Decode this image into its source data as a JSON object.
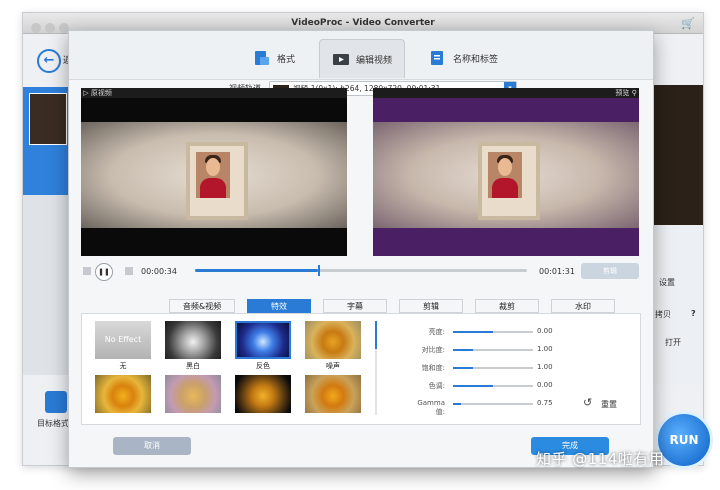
{
  "app": {
    "title": "VideoProc - Video Converter",
    "back_label": "返",
    "target_format_label": "目标格式",
    "run_label": "RUN",
    "right_panel": {
      "settings": "设置",
      "auto_copy": "拷贝",
      "question": "?",
      "open": "打开"
    }
  },
  "dialog": {
    "tabs": [
      {
        "label": "格式",
        "icon": "format-icon",
        "active": false
      },
      {
        "label": "编辑视频",
        "icon": "edit-video-icon",
        "active": true
      },
      {
        "label": "名称和标签",
        "icon": "name-tag-icon",
        "active": false
      }
    ],
    "track": {
      "label": "视频轨道",
      "value": "视频-1(0x1): h264, 1280x720, 00:01:31"
    },
    "source_label": "原视频",
    "preview_label": "预览",
    "player": {
      "current_time": "00:00:34",
      "end_time": "00:01:31",
      "progress": 0.37,
      "snapshot_label": "剪辑"
    },
    "edit_tabs": [
      {
        "label": "音频&视频",
        "active": false
      },
      {
        "label": "特效",
        "active": true
      },
      {
        "label": "字幕",
        "active": false
      },
      {
        "label": "剪辑",
        "active": false
      },
      {
        "label": "裁剪",
        "active": false
      },
      {
        "label": "水印",
        "active": false
      }
    ],
    "effects": [
      {
        "label": "无",
        "thumb_text": "No Effect",
        "style": "none",
        "selected": false
      },
      {
        "label": "黑白",
        "thumb_text": "",
        "style": "bw",
        "selected": false
      },
      {
        "label": "反色",
        "thumb_text": "",
        "style": "invert",
        "selected": true
      },
      {
        "label": "噪声",
        "thumb_text": "",
        "style": "noise",
        "selected": false
      },
      {
        "label": "",
        "thumb_text": "",
        "style": "vivid",
        "selected": false
      },
      {
        "label": "",
        "thumb_text": "",
        "style": "fade",
        "selected": false
      },
      {
        "label": "",
        "thumb_text": "",
        "style": "vignette",
        "selected": false
      },
      {
        "label": "",
        "thumb_text": "",
        "style": "warm",
        "selected": false
      }
    ],
    "adjustments": [
      {
        "label": "亮度:",
        "value": "0.00",
        "level": 0.5
      },
      {
        "label": "对比度:",
        "value": "1.00",
        "level": 0.25
      },
      {
        "label": "饱和度:",
        "value": "1.00",
        "level": 0.25
      },
      {
        "label": "色调:",
        "value": "0.00",
        "level": 0.5
      },
      {
        "label": "Gamma值:",
        "value": "0.75",
        "level": 0.1
      }
    ],
    "reset_label": "重置",
    "cancel_label": "取消",
    "done_label": "完成"
  },
  "watermark": "知乎 @114啦有用",
  "colors": {
    "accent": "#2a7bd6",
    "preview_tint": "#5a2a6e"
  }
}
